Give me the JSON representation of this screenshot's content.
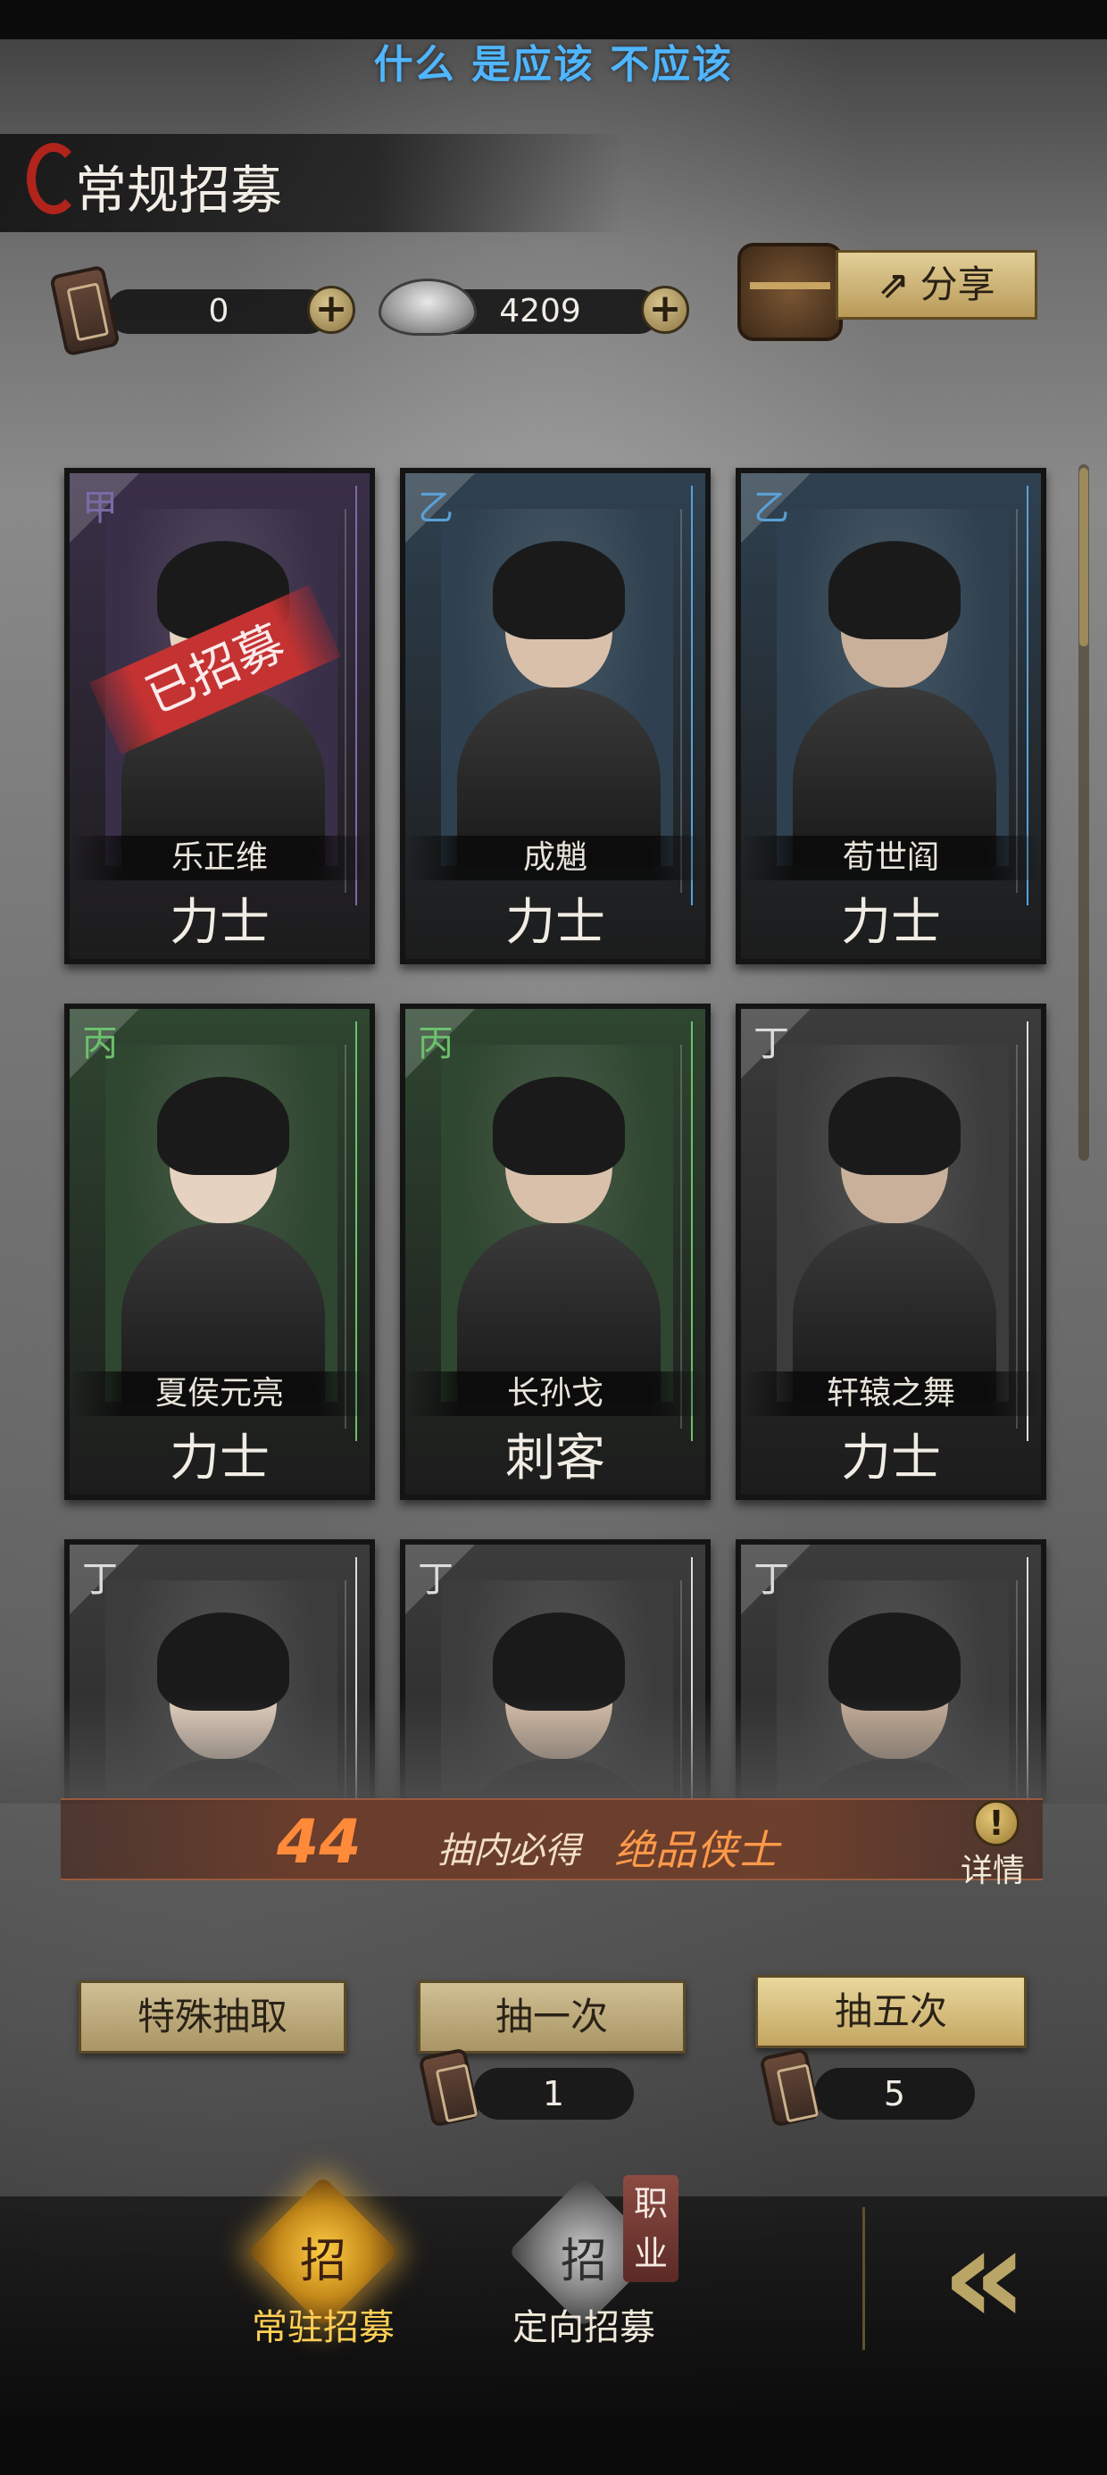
{
  "subtitle": "什么 是应该 不应该",
  "header": {
    "title": "常规招募",
    "recruit_token_count": "0",
    "ingot_count": "4209",
    "share_label": "分享"
  },
  "cards": [
    {
      "rank": "甲",
      "name": "乐正维",
      "class": "力士",
      "recruited": true,
      "stamp": "已招募",
      "theme": "#3a2f48"
    },
    {
      "rank": "乙",
      "name": "成魈",
      "class": "力士",
      "recruited": false,
      "theme": "#2f4150"
    },
    {
      "rank": "乙",
      "name": "荀世阎",
      "class": "力士",
      "recruited": false,
      "theme": "#2f4150"
    },
    {
      "rank": "丙",
      "name": "夏侯元亮",
      "class": "力士",
      "recruited": false,
      "theme": "#2f4630"
    },
    {
      "rank": "丙",
      "name": "长孙戈",
      "class": "刺客",
      "recruited": false,
      "theme": "#2f4630"
    },
    {
      "rank": "丁",
      "name": "轩辕之舞",
      "class": "力士",
      "recruited": false,
      "theme": "#3c3c3c"
    },
    {
      "rank": "丁",
      "name": "",
      "class": "",
      "recruited": false,
      "theme": "#3c3c3c"
    },
    {
      "rank": "丁",
      "name": "",
      "class": "",
      "recruited": false,
      "theme": "#3c3c3c"
    },
    {
      "rank": "丁",
      "name": "",
      "class": "",
      "recruited": false,
      "theme": "#3c3c3c"
    }
  ],
  "guarantee": {
    "count": "44",
    "text1": "抽内必得",
    "text2": "绝品侠士",
    "detail_label": "详情"
  },
  "actions": {
    "special_label": "特殊抽取",
    "single_label": "抽一次",
    "single_cost": "1",
    "five_label": "抽五次",
    "five_cost": "5"
  },
  "nav": {
    "tab1_label": "常驻招募",
    "tab1_glyph": "招",
    "tab2_label": "定向招募",
    "tab2_glyph": "招",
    "job_tag": "职业",
    "back_glyph": "«"
  },
  "colors": {
    "rank_jia": "#7c6aa8",
    "rank_yi": "#5aa0d6",
    "rank_bing": "#6cc06c",
    "rank_ding": "#dcdcdc",
    "subtitle": "#4fb6ff",
    "accent_gold": "#c4a661",
    "stamp_red": "#c43232"
  }
}
